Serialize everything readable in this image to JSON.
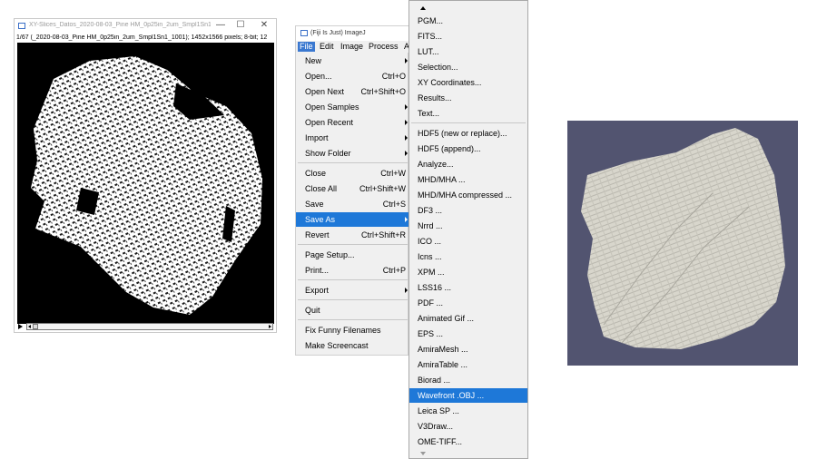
{
  "image_window": {
    "title": "XY-Slices_Datos_2020-08-03_Pine HM_0p25in_2um_Smpl1Sn1...",
    "minimize": "—",
    "maximize": "☐",
    "close": "✕",
    "info": "1/67 (_2020-08-03_Pine HM_0p25in_2um_Smpl1Sn1_1001); 1452x1566 pixels; 8-bit; 12"
  },
  "fiji_window": {
    "title": "(Fiji Is Just) ImageJ",
    "menubar": [
      "File",
      "Edit",
      "Image",
      "Process",
      "A"
    ]
  },
  "file_menu": {
    "items": [
      {
        "label": "New",
        "shortcut": "",
        "submenu": true
      },
      {
        "label": "Open...",
        "shortcut": "Ctrl+O",
        "submenu": false
      },
      {
        "label": "Open Next",
        "shortcut": "Ctrl+Shift+O",
        "submenu": false
      },
      {
        "label": "Open Samples",
        "shortcut": "",
        "submenu": true
      },
      {
        "label": "Open Recent",
        "shortcut": "",
        "submenu": true
      },
      {
        "label": "Import",
        "shortcut": "",
        "submenu": true
      },
      {
        "label": "Show Folder",
        "shortcut": "",
        "submenu": true
      },
      {
        "label": "Close",
        "shortcut": "Ctrl+W",
        "submenu": false
      },
      {
        "label": "Close All",
        "shortcut": "Ctrl+Shift+W",
        "submenu": false
      },
      {
        "label": "Save",
        "shortcut": "Ctrl+S",
        "submenu": false
      },
      {
        "label": "Save As",
        "shortcut": "",
        "submenu": true,
        "selected": true
      },
      {
        "label": "Revert",
        "shortcut": "Ctrl+Shift+R",
        "submenu": false
      },
      {
        "label": "Page Setup...",
        "shortcut": "",
        "submenu": false
      },
      {
        "label": "Print...",
        "shortcut": "Ctrl+P",
        "submenu": false
      },
      {
        "label": "Export",
        "shortcut": "",
        "submenu": true
      },
      {
        "label": "Quit",
        "shortcut": "",
        "submenu": false
      },
      {
        "label": "Fix Funny Filenames",
        "shortcut": "",
        "submenu": false
      },
      {
        "label": "Make Screencast",
        "shortcut": "",
        "submenu": false
      }
    ]
  },
  "save_as_menu": {
    "items": [
      "PGM...",
      "FITS...",
      "LUT...",
      "Selection...",
      "XY Coordinates...",
      "Results...",
      "Text...",
      "HDF5 (new or replace)...",
      "HDF5 (append)...",
      "Analyze...",
      "MHD/MHA ...",
      "MHD/MHA compressed ...",
      "DF3 ...",
      "Nrrd ...",
      "ICO ...",
      "Icns ...",
      "XPM ...",
      "LSS16 ...",
      "PDF ...",
      "Animated Gif ...",
      "EPS ...",
      "AmiraMesh ...",
      "AmiraTable ...",
      "Biorad ...",
      "Wavefront .OBJ ...",
      "Leica SP ...",
      "V3Draw...",
      "OME-TIFF..."
    ],
    "selected": "Wavefront .OBJ ..."
  },
  "colors": {
    "menu_highlight": "#1e78d8",
    "menu_background": "#f0f0f0",
    "render_background": "#525470",
    "sample_render": "#d8d6cc",
    "image_canvas": "#000000"
  }
}
